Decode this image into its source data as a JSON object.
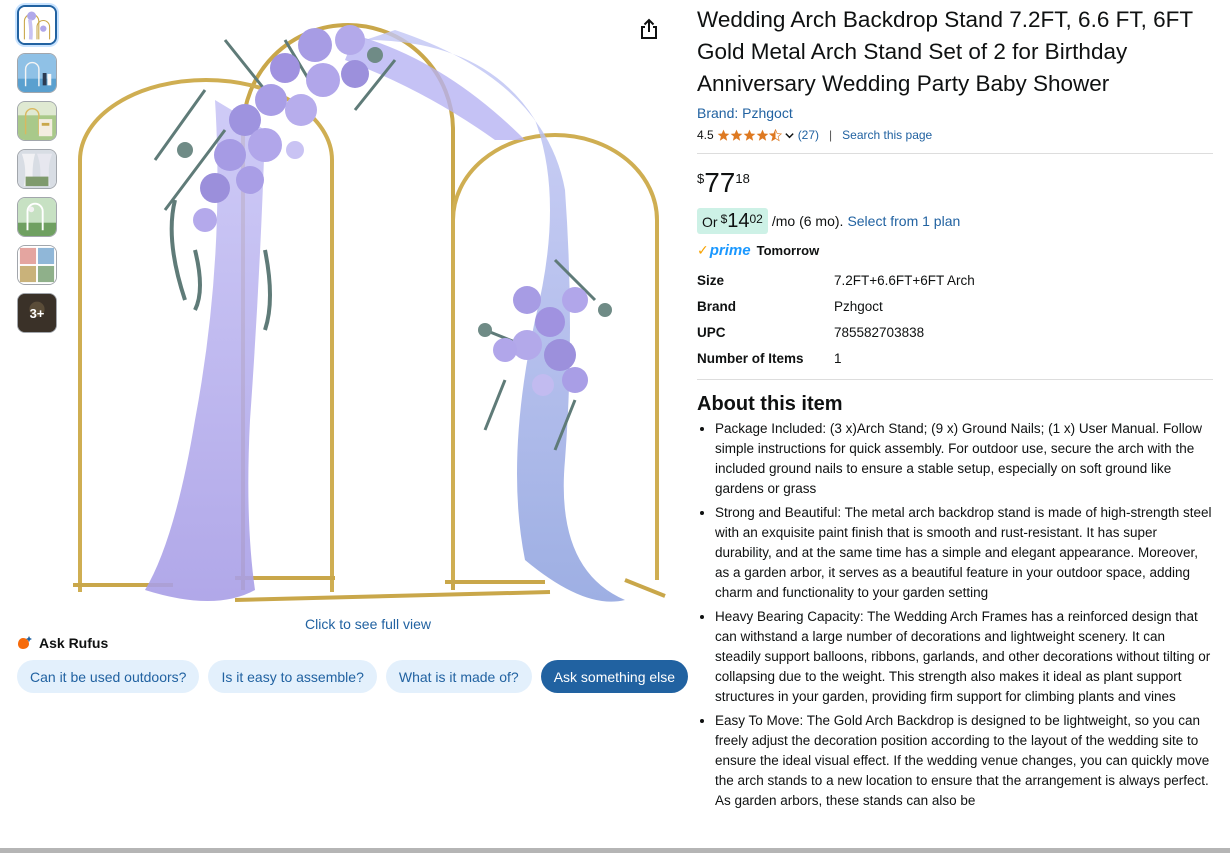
{
  "thumbnails": [
    {
      "name": "thumb-arch-main",
      "more_label": ""
    },
    {
      "name": "thumb-couple-beach",
      "more_label": ""
    },
    {
      "name": "thumb-garden-setup",
      "more_label": ""
    },
    {
      "name": "thumb-curtain",
      "more_label": ""
    },
    {
      "name": "thumb-outdoor-arch",
      "more_label": ""
    },
    {
      "name": "thumb-collage",
      "more_label": ""
    },
    {
      "name": "thumb-more",
      "more_label": "3+"
    }
  ],
  "image": {
    "full_view_label": "Click to see full view",
    "share_icon": "share-icon",
    "colors": {
      "gold": "#c9a74a",
      "lavender": "#b9b3ef",
      "rose": "#9f94de",
      "eucalyptus": "#5f7b78"
    }
  },
  "rufus": {
    "title": "Ask Rufus",
    "chips": [
      "Can it be used outdoors?",
      "Is it easy to assemble?",
      "What is it made of?"
    ],
    "primary_chip": "Ask something else"
  },
  "product": {
    "title": "Wedding Arch Backdrop Stand 7.2FT, 6.6 FT, 6FT Gold Metal Arch Stand Set of 2 for Birthday Anniversary Wedding Party Baby Shower",
    "brand_link": "Brand: Pzhgoct",
    "rating": "4.5",
    "rating_stars": 4.5,
    "review_count": "(27)",
    "separator": "|",
    "search_page": "Search this page",
    "price": {
      "symbol": "$",
      "whole": "77",
      "fraction": "18"
    },
    "monthly": {
      "or": "Or",
      "symbol": "$",
      "whole": "14",
      "fraction": "02",
      "term": "/mo (6 mo).",
      "link": "Select from 1 plan"
    },
    "prime": {
      "check": "✓",
      "word": "prime",
      "delivery": "Tomorrow"
    },
    "specs": [
      {
        "key": "Size",
        "value": "7.2FT+6.6FT+6FT Arch"
      },
      {
        "key": "Brand",
        "value": "Pzhgoct"
      },
      {
        "key": "UPC",
        "value": "785582703838"
      },
      {
        "key": "Number of Items",
        "value": "1"
      }
    ],
    "about_heading": "About this item",
    "bullets": [
      "Package Included: (3 x)Arch Stand; (9 x) Ground Nails; (1 x) User Manual. Follow simple instructions for quick assembly. For outdoor use, secure the arch with the included ground nails to ensure a stable setup, especially on soft ground like gardens or grass",
      "Strong and Beautiful: The metal arch backdrop stand is made of high-strength steel with an exquisite paint finish that is smooth and rust-resistant. It has super durability, and at the same time has a simple and elegant appearance. Moreover, as a garden arbor, it serves as a beautiful feature in your outdoor space, adding charm and functionality to your garden setting",
      "Heavy Bearing Capacity: The Wedding Arch Frames has a reinforced design that can withstand a large number of decorations and lightweight scenery. It can steadily support balloons, ribbons, garlands, and other decorations without tilting or collapsing due to the weight. This strength also makes it ideal as plant support structures in your garden, providing firm support for climbing plants and vines",
      "Easy To Move: The Gold Arch Backdrop is designed to be lightweight, so you can freely adjust the decoration position according to the layout of the wedding site to ensure the ideal visual effect. If the wedding venue changes, you can quickly move the arch stands to a new location to ensure that the arrangement is always perfect. As garden arbors, these stands can also be"
    ]
  }
}
